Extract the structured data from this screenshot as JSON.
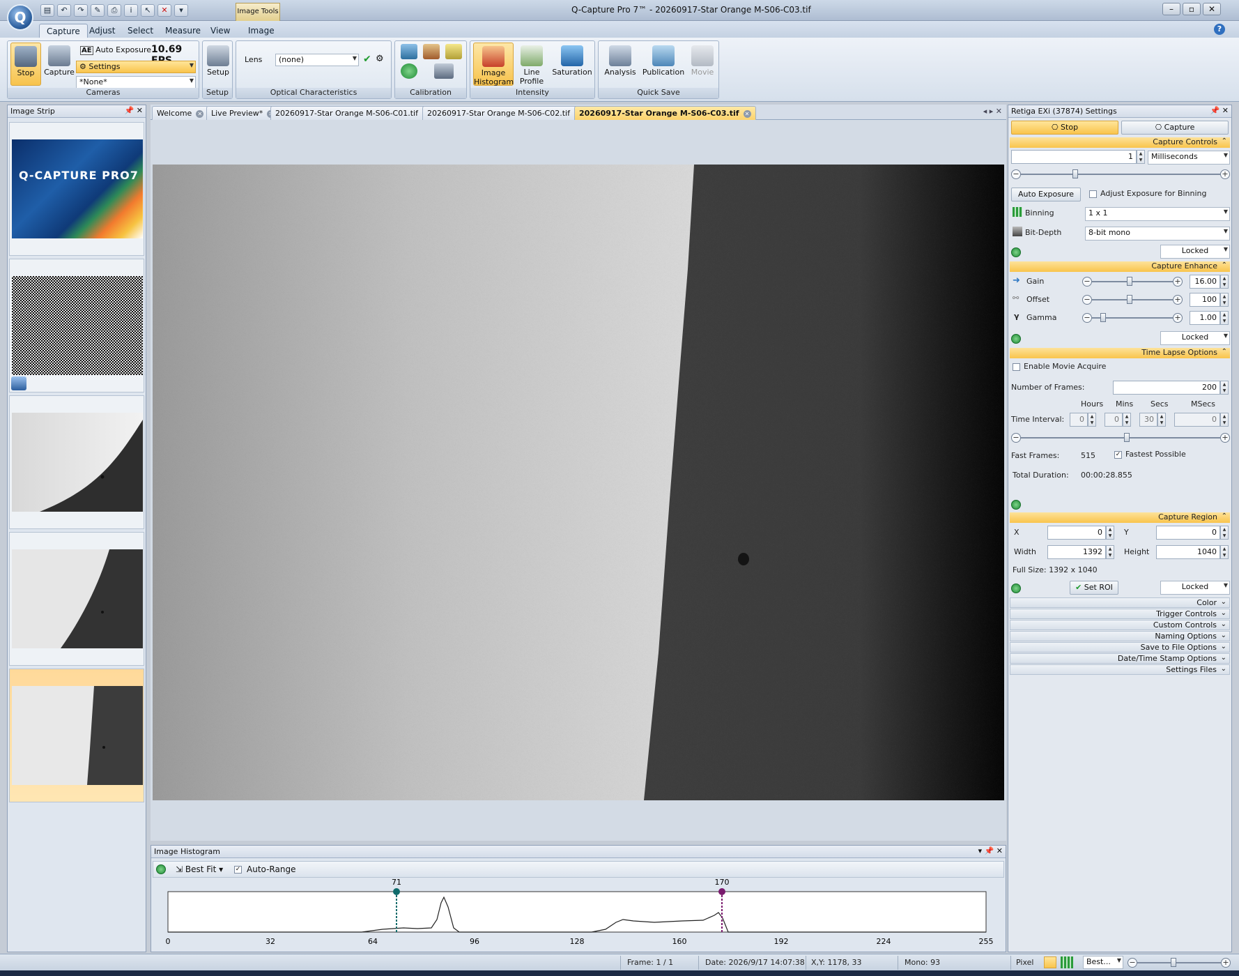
{
  "window": {
    "title": "Q-Capture Pro 7™ - 20260917-Star Orange M-S06-C03.tif",
    "context_tab": "Image Tools"
  },
  "menu_tabs": [
    "Capture",
    "Adjust",
    "Select",
    "Measure",
    "View",
    "Image"
  ],
  "ribbon": {
    "cameras": {
      "stop": "Stop",
      "capture": "Capture",
      "auto_exposure": "Auto Exposure",
      "fps": "10.69 FPS",
      "settings": "Settings",
      "preset": "*None*",
      "label": "Cameras"
    },
    "setup": {
      "button": "Setup",
      "label": "Setup"
    },
    "optical": {
      "lens_label": "Lens",
      "lens_value": "(none)",
      "label": "Optical Characteristics"
    },
    "calibration": {
      "label": "Calibration"
    },
    "intensity": {
      "image_histogram": "Image Histogram",
      "line_profile": "Line Profile",
      "saturation": "Saturation",
      "label": "Intensity"
    },
    "quick_save": {
      "analysis": "Analysis",
      "publication": "Publication",
      "movie": "Movie",
      "label": "Quick Save"
    }
  },
  "image_strip": {
    "title": "Image Strip",
    "splash_brand": "Q-CAPTURE PRO7"
  },
  "doc_tabs": [
    "Welcome",
    "Live Preview*",
    "20260917-Star Orange M-S06-C01.tif",
    "20260917-Star Orange M-S06-C02.tif",
    "20260917-Star Orange M-S06-C03.tif"
  ],
  "histogram": {
    "title": "Image Histogram",
    "best_fit": "Best Fit",
    "auto_range": "Auto-Range",
    "low_marker": "71",
    "high_marker": "170",
    "ticks": [
      "0",
      "32",
      "64",
      "96",
      "128",
      "160",
      "192",
      "224",
      "255"
    ]
  },
  "settings": {
    "title": "Retiga EXi (37874) Settings",
    "stop": "Stop",
    "capture": "Capture",
    "capture_controls": {
      "header": "Capture Controls",
      "exposure_value": "1",
      "exposure_unit": "Milliseconds",
      "auto_exposure": "Auto Exposure",
      "adjust_binning": "Adjust Exposure for Binning",
      "binning_label": "Binning",
      "binning_value": "1 x 1",
      "bitdepth_label": "Bit-Depth",
      "bitdepth_value": "8-bit mono",
      "locked": "Locked"
    },
    "capture_enhance": {
      "header": "Capture Enhance",
      "gain_label": "Gain",
      "gain_value": "16.00",
      "offset_label": "Offset",
      "offset_value": "100",
      "gamma_label": "Gamma",
      "gamma_value": "1.00",
      "locked": "Locked"
    },
    "time_lapse": {
      "header": "Time Lapse Options",
      "enable_movie": "Enable Movie Acquire",
      "frames_label": "Number of  Frames:",
      "frames_value": "200",
      "interval_label": "Time Interval:",
      "hours_h": "Hours",
      "mins_h": "Mins",
      "secs_h": "Secs",
      "msecs_h": "MSecs",
      "hours": "0",
      "mins": "0",
      "secs": "30",
      "msecs": "0",
      "fast_frames_label": "Fast Frames:",
      "fast_frames_value": "515",
      "fastest_possible": "Fastest Possible",
      "total_label": "Total Duration:",
      "total_value": "00:00:28.855"
    },
    "capture_region": {
      "header": "Capture Region",
      "x_label": "X",
      "x_value": "0",
      "y_label": "Y",
      "y_value": "0",
      "width_label": "Width",
      "width_value": "1392",
      "height_label": "Height",
      "height_value": "1040",
      "full_size": "Full Size: 1392 x 1040",
      "set_roi": "Set ROI",
      "locked": "Locked"
    },
    "collapsed_sections": [
      "Color",
      "Trigger Controls",
      "Custom Controls",
      "Naming Options",
      "Save to File Options",
      "Date/Time Stamp Options",
      "Settings Files"
    ]
  },
  "status": {
    "frame": "Frame: 1 / 1",
    "date": "Date: 2026/9/17 14:07:38",
    "xy": "X,Y: 1178,    33",
    "mono": "Mono:    93",
    "pixel": "Pixel",
    "zoom": "Best..."
  },
  "colors": {
    "accent": "#f9c44c",
    "chrome": "#d6e0ec",
    "low_marker": "#0f6b6b",
    "high_marker": "#7a1a6e"
  }
}
